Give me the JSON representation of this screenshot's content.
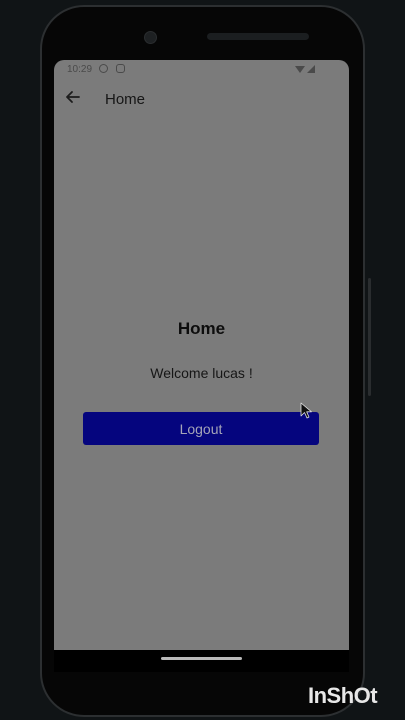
{
  "status_bar": {
    "time": "10:29",
    "icons": [
      "privacy-shield-icon",
      "notification-icon",
      "wifi-icon",
      "cellular-signal-icon"
    ]
  },
  "app_bar": {
    "back_icon": "arrow-left-icon",
    "title": "Home"
  },
  "content": {
    "heading": "Home",
    "welcome_message": "Welcome lucas !",
    "logout_label": "Logout"
  },
  "colors": {
    "screen_dim_background": "#7b7b7b",
    "logout_button": "#05057e",
    "logout_text": "#a5a5b8"
  },
  "watermark": {
    "text": "InShOt"
  }
}
